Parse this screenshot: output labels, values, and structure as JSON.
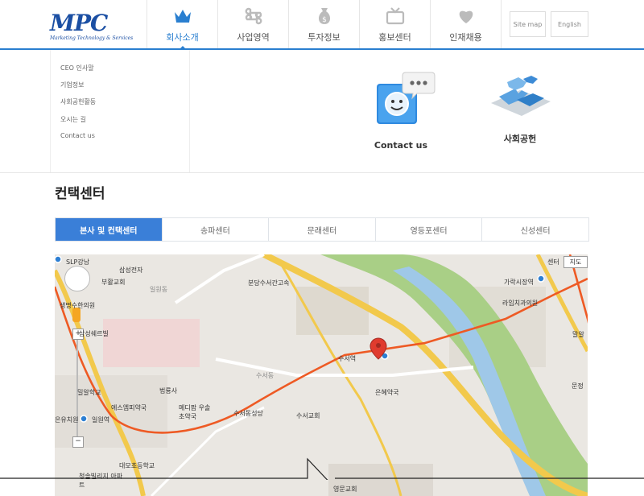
{
  "logo": {
    "mark": "MPC",
    "tagline": "Marketing Technology & Services"
  },
  "nav": [
    {
      "label": "회사소개",
      "icon": "crown-icon"
    },
    {
      "label": "사업영역",
      "icon": "command-icon"
    },
    {
      "label": "투자정보",
      "icon": "money-bag-icon"
    },
    {
      "label": "홍보센터",
      "icon": "tv-icon"
    },
    {
      "label": "인재채용",
      "icon": "heart-icon"
    }
  ],
  "util": {
    "sitemap": "Site map",
    "english": "English"
  },
  "submenu": [
    "CEO 인사말",
    "기업정보",
    "사회공헌활동",
    "오시는 길",
    "Contact us"
  ],
  "promos": [
    {
      "label": "Contact us",
      "icon": "chat-face-icon"
    },
    {
      "label": "사회공헌",
      "icon": "puzzle-icon"
    }
  ],
  "page_title": "컨택센터",
  "tabs": [
    "본사 및 컨택센터",
    "송파센터",
    "문래센터",
    "영등포센터",
    "신성센터"
  ],
  "map": {
    "map_type_label": "지도",
    "places": [
      "SLP강남",
      "삼성전자",
      "부활교회",
      "생명수한의원",
      "삼성쉐르빌",
      "분당수서간고속",
      "밀알학교",
      "법룡사",
      "에스엠피약국",
      "메디팜 우솔초약국",
      "수서동성당",
      "수서교회",
      "은혜약국",
      "수서역",
      "가락시장역",
      "라임치과의원",
      "대모초등학교",
      "청솔빌리지 아파트",
      "영문교회",
      "일원역",
      "은유치원",
      "말알",
      "일원동",
      "수서동",
      "센터",
      "문정"
    ]
  },
  "colors": {
    "accent": "#2a7fd0",
    "tab_active": "#3a7fd8",
    "logo": "#1b4fa3"
  }
}
